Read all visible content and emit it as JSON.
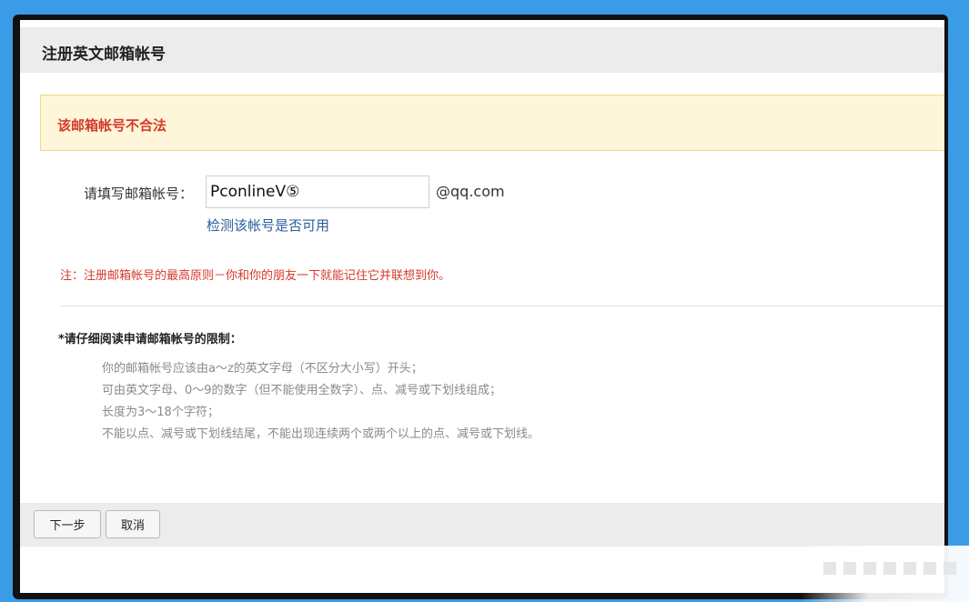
{
  "dialog": {
    "title": "注册英文邮箱帐号"
  },
  "alert": {
    "message": "该邮箱帐号不合法"
  },
  "form": {
    "label": "请填写邮箱帐号：",
    "email_value": "PconlineV⑤",
    "domain_suffix": "@qq.com",
    "check_link": "检测该帐号是否可用"
  },
  "note": "注：注册邮箱帐号的最高原则－你和你的朋友一下就能记住它并联想到你。",
  "rules": {
    "heading": "*请仔细阅读申请邮箱帐号的限制：",
    "items": [
      "你的邮箱帐号应该由a～z的英文字母（不区分大小写）开头；",
      "可由英文字母、0～9的数字（但不能使用全数字）、点、减号或下划线组成；",
      "长度为3～18个字符；",
      "不能以点、减号或下划线结尾，不能出现连续两个或两个以上的点、减号或下划线。"
    ]
  },
  "footer": {
    "next_label": "下一步",
    "cancel_label": "取消"
  },
  "colors": {
    "background": "#3a9be6",
    "alert_text": "#d63a2b",
    "alert_bg": "#fdf6d9",
    "link": "#2b5d9b"
  }
}
